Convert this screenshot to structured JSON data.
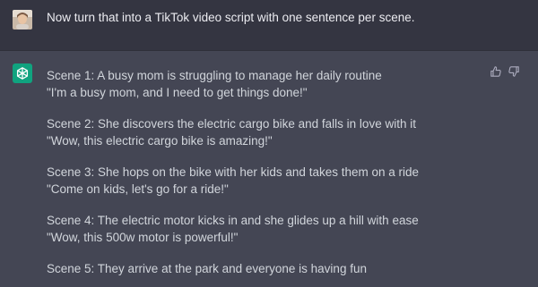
{
  "user_message": {
    "avatar": "user-avatar-photo",
    "text": "Now turn that into a TikTok video script with one sentence per scene."
  },
  "assistant_message": {
    "avatar": "openai-logo-icon",
    "feedback": {
      "thumbs_up": "thumbs-up-icon",
      "thumbs_down": "thumbs-down-icon"
    },
    "scenes": [
      {
        "description": "Scene 1: A busy mom is struggling to manage her daily routine",
        "quote": "\"I'm a busy mom, and I need to get things done!\""
      },
      {
        "description": "Scene 2: She discovers the electric cargo bike and falls in love with it",
        "quote": "\"Wow, this electric cargo bike is amazing!\""
      },
      {
        "description": "Scene 3: She hops on the bike with her kids and takes them on a ride",
        "quote": "\"Come on kids, let's go for a ride!\""
      },
      {
        "description": "Scene 4: The electric motor kicks in and she glides up a hill with ease",
        "quote": "\"Wow, this 500w motor is powerful!\""
      },
      {
        "description": "Scene 5: They arrive at the park and everyone is having fun",
        "quote": ""
      }
    ]
  },
  "colors": {
    "user_bg": "#343541",
    "assistant_bg": "#444654",
    "accent": "#10a37f",
    "text": "#d1d5db"
  }
}
